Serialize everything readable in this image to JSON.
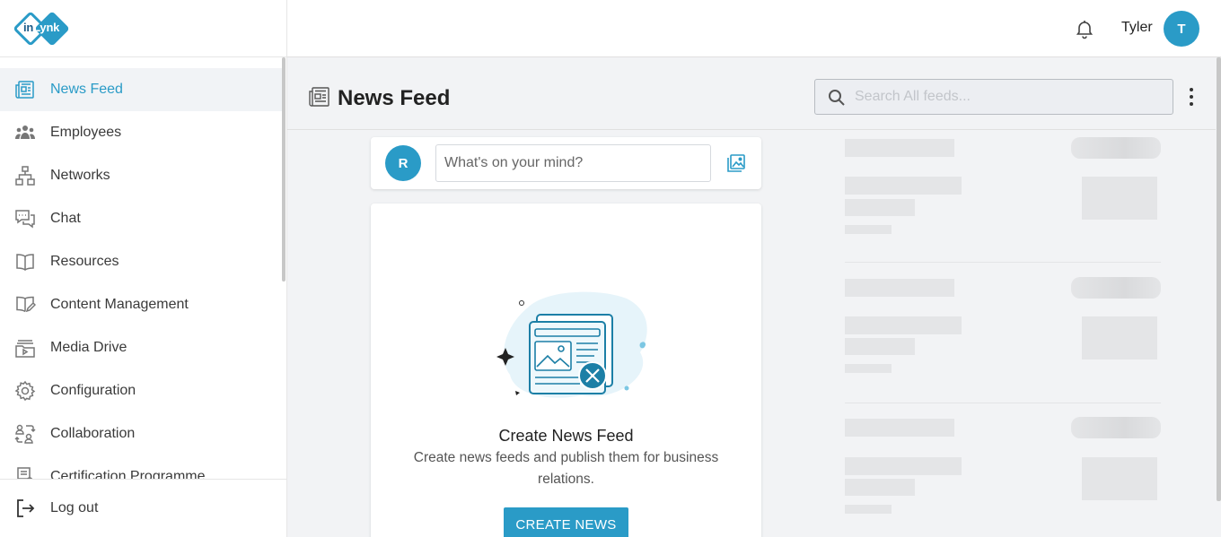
{
  "app": {
    "logo_text_left": "in",
    "logo_text_right": "Lynk",
    "brand_color": "#2a9bc7"
  },
  "sidebar": {
    "items": [
      {
        "label": "News Feed",
        "icon": "newspaper-icon",
        "active": true
      },
      {
        "label": "Employees",
        "icon": "people-icon",
        "active": false
      },
      {
        "label": "Networks",
        "icon": "network-icon",
        "active": false
      },
      {
        "label": "Chat",
        "icon": "chat-icon",
        "active": false
      },
      {
        "label": "Resources",
        "icon": "book-icon",
        "active": false
      },
      {
        "label": "Content Management",
        "icon": "book-edit-icon",
        "active": false
      },
      {
        "label": "Media Drive",
        "icon": "media-folder-icon",
        "active": false
      },
      {
        "label": "Configuration",
        "icon": "gear-icon",
        "active": false
      },
      {
        "label": "Collaboration",
        "icon": "collaboration-icon",
        "active": false
      },
      {
        "label": "Certification Programme",
        "icon": "certificate-icon",
        "active": false
      }
    ],
    "logout_label": "Log out"
  },
  "header": {
    "username": "Tyler",
    "avatar_initial": "T"
  },
  "page": {
    "title": "News Feed",
    "search_placeholder": "Search All feeds..."
  },
  "composer": {
    "avatar_initial": "R",
    "placeholder": "What's on your mind?"
  },
  "empty_state": {
    "title": "Create News Feed",
    "description": "Create news feeds and publish them for business relations.",
    "button_label": "CREATE NEWS"
  }
}
